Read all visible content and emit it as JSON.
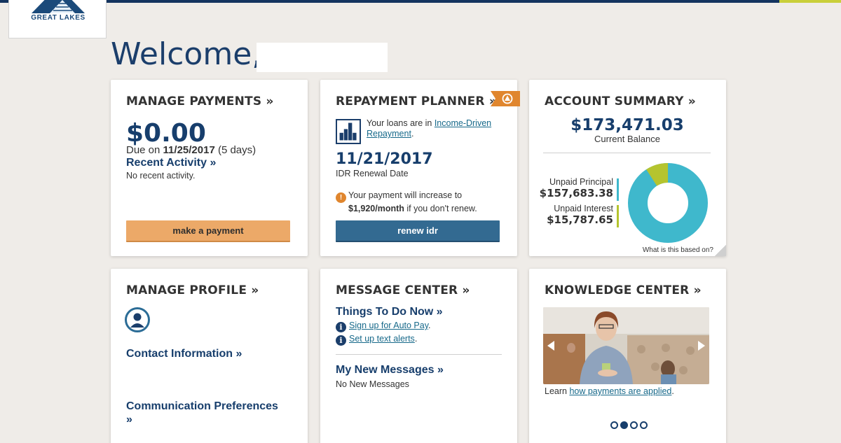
{
  "brand": {
    "logo_text": "GREAT LAKES",
    "primary": "#173e6c",
    "accent": "#c9cf3a"
  },
  "welcome": "Welcome,",
  "manage_payments": {
    "title": "MANAGE PAYMENTS »",
    "amount": "$0.00",
    "due_prefix": "Due on ",
    "due_date": "11/25/2017",
    "due_suffix": " (5 days)",
    "recent_activity": "Recent Activity »",
    "no_recent": "No recent activity.",
    "button": "make a payment"
  },
  "repayment_planner": {
    "title": "REPAYMENT PLANNER »",
    "badge_icon": "warning-icon",
    "loans_text": "Your loans are in ",
    "plan_link": "Income-Driven Repayment",
    "period": ".",
    "renewal_date": "11/21/2017",
    "renewal_label": "IDR Renewal Date",
    "warning_text": "Your payment will increase to",
    "warning_amount": "$1,920/month",
    "warning_suffix": " if you don't renew.",
    "button": "renew idr"
  },
  "account_summary": {
    "title": "ACCOUNT SUMMARY »",
    "balance": "$173,471.03",
    "balance_label": "Current Balance",
    "principal_label": "Unpaid Principal",
    "principal_value": "$157,683.38",
    "interest_label": "Unpaid Interest",
    "interest_value": "$15,787.65",
    "principal_color": "#3fb8cc",
    "interest_color": "#b5c42f",
    "principal_amount": 157683.38,
    "interest_amount": 15787.65,
    "based_on": "What is this based on?"
  },
  "manage_profile": {
    "title": "MANAGE PROFILE »",
    "avatar_icon": "user-icon",
    "contact": "Contact Information »",
    "comm_line1": "Communication Preferences",
    "comm_line2": "»"
  },
  "message_center": {
    "title": "MESSAGE CENTER »",
    "todo_head": "Things To Do Now »",
    "todo_items": [
      "Sign up for Auto Pay",
      "Set up text alerts"
    ],
    "todo_period": ".",
    "messages_head": "My New Messages »",
    "no_messages": "No New Messages"
  },
  "knowledge_center": {
    "title": "KNOWLEDGE CENTER »",
    "learn_prefix": "Learn ",
    "learn_link": "how payments are applied",
    "learn_suffix": ".",
    "carousel_dots": 4,
    "active_dot": 1
  }
}
